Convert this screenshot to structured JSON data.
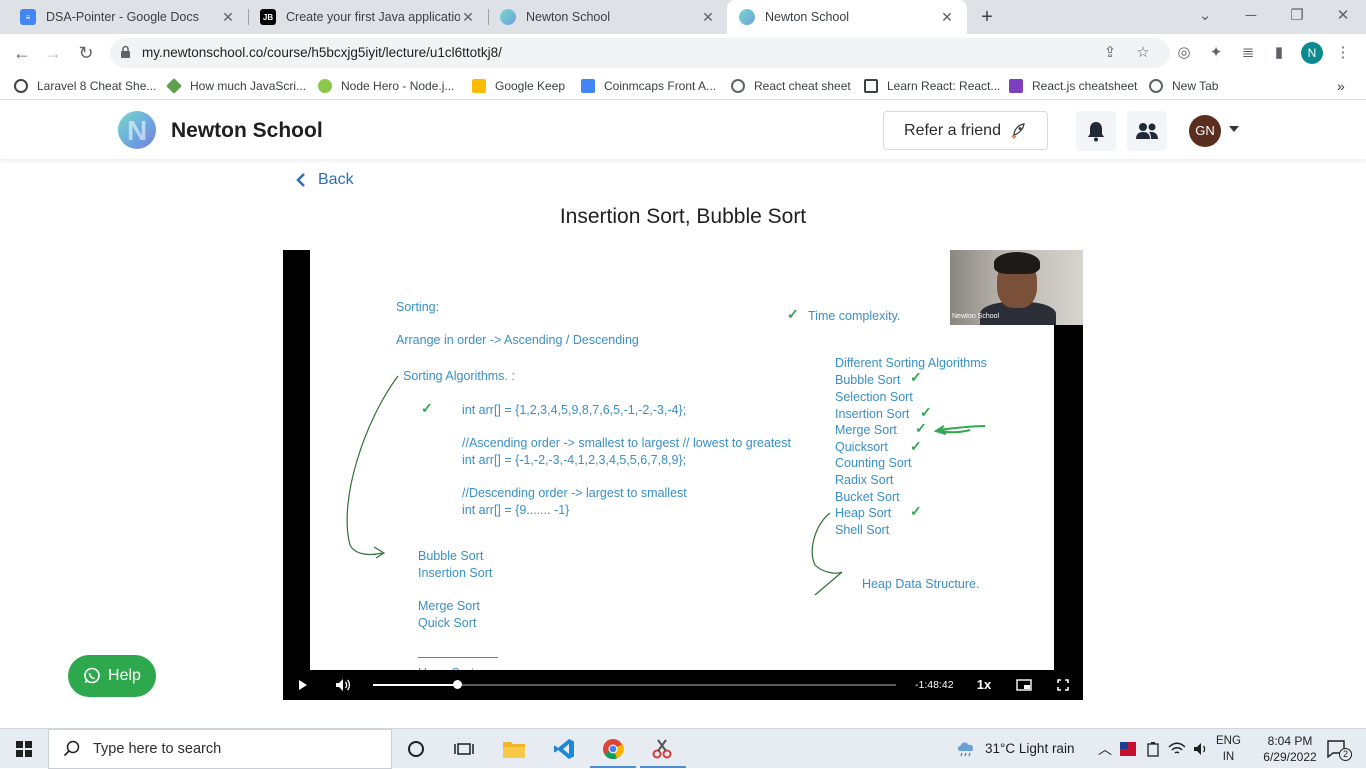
{
  "browser": {
    "tabs": [
      {
        "title": "DSA-Pointer - Google Docs",
        "icon": "google-docs-icon",
        "color": "#4285f4"
      },
      {
        "title": "Create your first Java application",
        "icon": "jetbrains-icon",
        "color": "#000000"
      },
      {
        "title": "Newton School",
        "icon": "newton-school-icon",
        "color": "#6ab0e0"
      },
      {
        "title": "Newton School",
        "icon": "newton-school-icon",
        "color": "#6ab0e0"
      }
    ],
    "url": "my.newtonschool.co/course/h5bcxjg5iyit/lecture/u1cl6ttotkj8/",
    "profile_initial": "N",
    "bookmarks": [
      {
        "label": "Laravel 8 Cheat She...",
        "icon": "laravel-icon"
      },
      {
        "label": "How much JavaScri...",
        "icon": "nodejs-icon"
      },
      {
        "label": "Node Hero - Node.j...",
        "icon": "node-hero-icon"
      },
      {
        "label": "Google Keep",
        "icon": "google-keep-icon"
      },
      {
        "label": "Coinmcaps Front A...",
        "icon": "google-docs-icon"
      },
      {
        "label": "React cheat sheet",
        "icon": "globe-icon"
      },
      {
        "label": "Learn React: React...",
        "icon": "page-icon"
      },
      {
        "label": "React.js cheatsheet",
        "icon": "devhints-icon"
      },
      {
        "label": "New Tab",
        "icon": "globe-icon"
      }
    ]
  },
  "site": {
    "brand": "Newton School",
    "refer_label": "Refer a friend",
    "avatar_initials": "GN",
    "accent": "#2a6fb4"
  },
  "page": {
    "back_label": "Back",
    "lecture_title": "Insertion Sort, Bubble Sort"
  },
  "whiteboard": {
    "heading": "Sorting:",
    "definition": "Arrange in order -> Ascending / Descending",
    "algorithms_label": "Sorting Algorithms. :",
    "code": [
      "int arr[] = {1,2,3,4,5,9,8,7,6,5,-1,-2,-3,-4};",
      "//Ascending order -> smallest to largest // lowest to greatest",
      "int arr[] = {-1,-2,-3,-4,1,2,3,4,5,5,6,7,8,9};",
      "//Descending order -> largest to smallest",
      "int arr[] = {9....... -1}"
    ],
    "left_list": [
      "Bubble Sort",
      "Insertion Sort",
      "Merge Sort",
      "Quick Sort",
      "Heap Sort"
    ],
    "time_complexity": "Time complexity.",
    "different_heading": "Different Sorting Algorithms",
    "right_list": [
      {
        "name": "Bubble Sort",
        "checked": true
      },
      {
        "name": "Selection Sort",
        "checked": false
      },
      {
        "name": "Insertion Sort",
        "checked": true
      },
      {
        "name": "Merge Sort",
        "checked": true
      },
      {
        "name": "Quicksort",
        "checked": true
      },
      {
        "name": "Counting Sort",
        "checked": false
      },
      {
        "name": "Radix Sort",
        "checked": false
      },
      {
        "name": "Bucket Sort",
        "checked": false
      },
      {
        "name": "Heap Sort",
        "checked": true
      },
      {
        "name": "Shell Sort",
        "checked": false
      }
    ],
    "heap_note": "Heap Data Structure.",
    "ink_color": "#3a8fc6",
    "check_color": "#2fa84f"
  },
  "video": {
    "webcam_watermark": "Newton School",
    "time_remaining": "-1:48:42",
    "speed": "1x",
    "progress": 0.16
  },
  "help": {
    "label": "Help",
    "color": "#2ea84c"
  },
  "taskbar": {
    "search_placeholder": "Type here to search",
    "weather": "31°C  Light rain",
    "lang": "ENG",
    "region": "IN",
    "time": "8:04 PM",
    "date": "6/29/2022",
    "notification_count": "2"
  }
}
